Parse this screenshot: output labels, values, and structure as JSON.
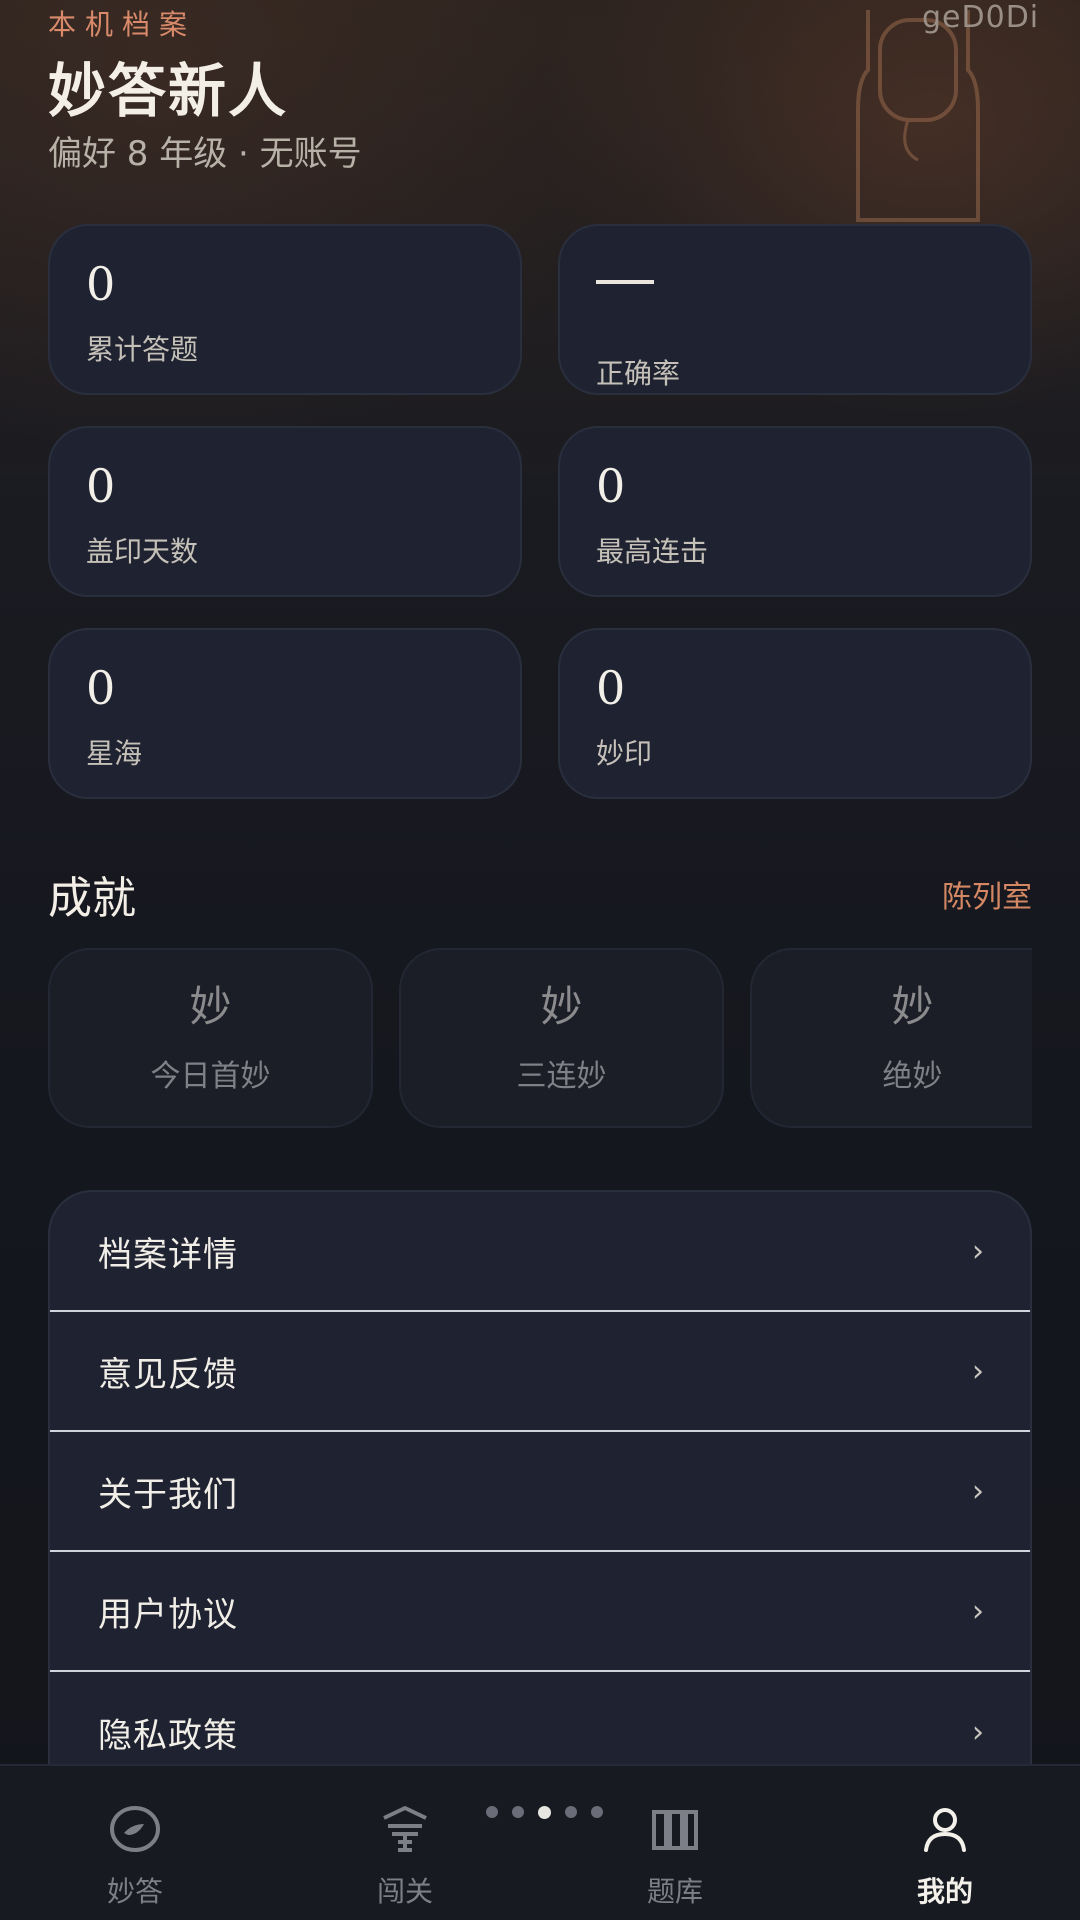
{
  "watermark": "geD0Di",
  "header": {
    "eyebrow": "本机档案",
    "title": "妙答新人",
    "subtitle": "偏好 8 年级 · 无账号"
  },
  "stats": [
    {
      "value": "0",
      "label": "累计答题"
    },
    {
      "value": "—",
      "label": "正确率"
    },
    {
      "value": "0",
      "label": "盖印天数"
    },
    {
      "value": "0",
      "label": "最高连击"
    },
    {
      "value": "0",
      "label": "星海"
    },
    {
      "value": "0",
      "label": "妙印"
    }
  ],
  "achievements": {
    "title": "成就",
    "link": "陈列室",
    "items": [
      {
        "glyph": "妙",
        "name": "今日首妙"
      },
      {
        "glyph": "妙",
        "name": "三连妙"
      },
      {
        "glyph": "妙",
        "name": "绝妙"
      }
    ]
  },
  "menu": [
    {
      "label": "档案详情",
      "chevron": "›"
    },
    {
      "label": "意见反馈",
      "chevron": "›"
    },
    {
      "label": "关于我们",
      "chevron": "›"
    },
    {
      "label": "用户协议",
      "chevron": "›"
    },
    {
      "label": "隐私政策",
      "chevron": "›"
    }
  ],
  "tabbar": {
    "items": [
      {
        "label": "妙答",
        "icon": "eye-icon",
        "active": false
      },
      {
        "label": "闯关",
        "icon": "tower-icon",
        "active": false
      },
      {
        "label": "题库",
        "icon": "book-icon",
        "active": false
      },
      {
        "label": "我的",
        "icon": "person-icon",
        "active": true
      }
    ],
    "page_dots": 5,
    "active_dot": 2
  },
  "colors": {
    "accent": "#d48763",
    "card": "#1f2331",
    "background": "#14161d"
  }
}
